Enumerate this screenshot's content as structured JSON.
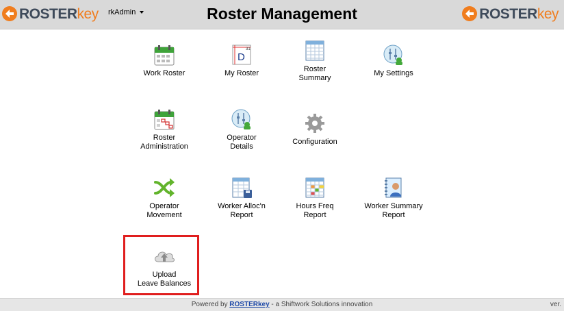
{
  "header": {
    "logo_left": {
      "roster": "ROSTER",
      "key": "key"
    },
    "logo_right": {
      "roster": "ROSTER",
      "key": "key"
    },
    "user_menu": "rkAdmin",
    "title": "Roster Management"
  },
  "tiles": [
    {
      "label": "Work Roster",
      "icon": "calendar-icon"
    },
    {
      "label": "My Roster",
      "icon": "day-calendar-icon"
    },
    {
      "label": "Roster\nSummary",
      "icon": "grid-table-icon"
    },
    {
      "label": "My Settings",
      "icon": "user-settings-icon"
    },
    {
      "label": "Roster\nAdministration",
      "icon": "roster-admin-calendar-icon"
    },
    {
      "label": "Operator\nDetails",
      "icon": "operator-settings-icon"
    },
    {
      "label": "Configuration",
      "icon": "gear-icon"
    },
    {
      "label": "Operator\nMovement",
      "icon": "shuffle-icon"
    },
    {
      "label": "Worker Alloc'n\nReport",
      "icon": "report-save-icon"
    },
    {
      "label": "Hours Freq\nReport",
      "icon": "colored-grid-report-icon"
    },
    {
      "label": "Worker Summary\nReport",
      "icon": "person-notebook-icon"
    },
    {
      "label": "Upload\nLeave Balances",
      "icon": "cloud-upload-icon"
    }
  ],
  "footer": {
    "prefix": "Powered by ",
    "link": "ROSTERkey",
    "suffix": " - a Shiftwork Solutions innovation",
    "version": "ver."
  },
  "colors": {
    "brand_dark": "#3e4a5a",
    "brand_orange": "#f07d1e",
    "highlight": "#e01e1e",
    "header_bg": "#d9d9d9"
  }
}
